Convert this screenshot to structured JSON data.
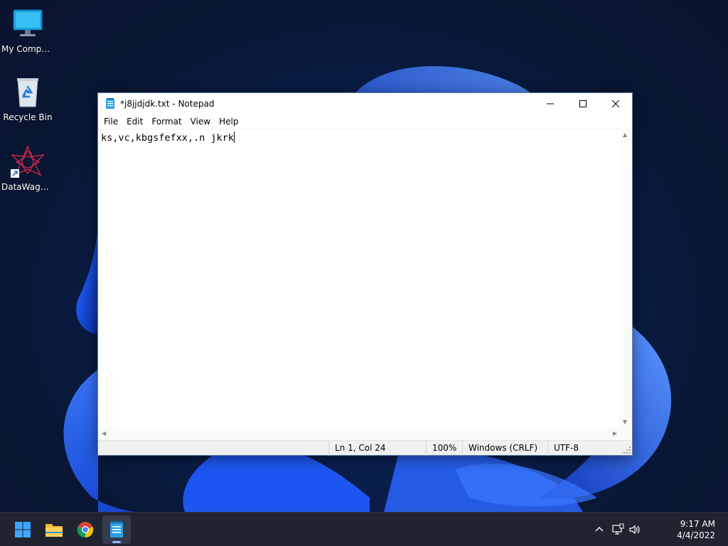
{
  "desktop": {
    "icons": [
      {
        "label": "My Computer",
        "icon": "monitor-icon"
      },
      {
        "label": "Recycle Bin",
        "icon": "recycle-bin-icon"
      },
      {
        "label": "DataWagon...",
        "icon": "datawagon-app-icon"
      }
    ]
  },
  "notepad": {
    "title": "*j8jjdjdk.txt - Notepad",
    "menu": [
      "File",
      "Edit",
      "Format",
      "View",
      "Help"
    ],
    "content": "ks,vc,kbgsfefxx,.n jkrk",
    "status": {
      "position": "Ln 1, Col 24",
      "zoom": "100%",
      "line_ending": "Windows (CRLF)",
      "encoding": "UTF-8"
    }
  },
  "taskbar": {
    "apps": [
      "start-icon",
      "file-explorer-icon",
      "chrome-icon",
      "notepad-icon"
    ],
    "active_app": "notepad-icon",
    "clock": {
      "time": "9:17 AM",
      "date": "4/4/2022"
    }
  },
  "colors": {
    "taskbar": "#1f2430",
    "wallpaper_bloom": "#1f5cff",
    "accent": "#0078d4"
  }
}
